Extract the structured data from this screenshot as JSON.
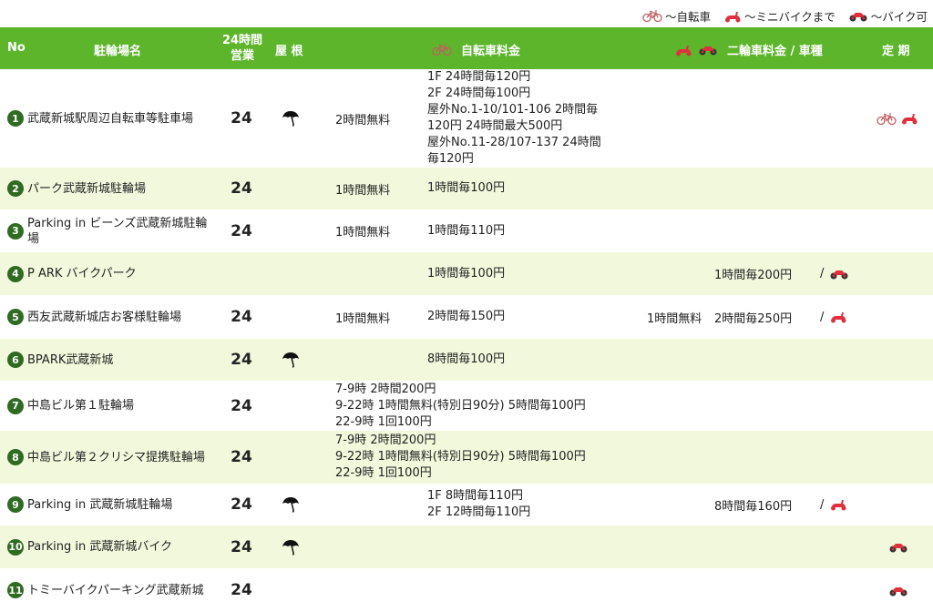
{
  "legend": [
    {
      "icon": "bicycle-icon",
      "label": "～自転車"
    },
    {
      "icon": "scooter-icon",
      "label": "～ミニバイクまで"
    },
    {
      "icon": "motorcycle-icon",
      "label": "～バイク可"
    }
  ],
  "header": {
    "no": "No",
    "name": "駐輪場名",
    "h24_line1": "24時間",
    "h24_line2": "営業",
    "roof": "屋 根",
    "bike_fee": "自転車料金",
    "moto_fee": "二輪車料金 / 車種",
    "pass": "定 期"
  },
  "colors": {
    "header_bg": "#5db52b",
    "alt_row": "#f2f8dc",
    "number_badge": "#2f6b22",
    "scooter": "#e0303c"
  },
  "rows": [
    {
      "no": "1",
      "name": "武蔵新城駅周辺自転車等駐車場",
      "h24": "24",
      "roof": true,
      "free": "2時間無料",
      "fees": [
        "1F 24時間毎120円",
        "2F 24時間毎100円",
        "屋外No.1-10/101-106 2時間毎",
        "120円 24時間最大500円",
        "屋外No.11-28/107-137 24時間",
        "毎120円"
      ],
      "moto_free": "",
      "moto_fee": "",
      "moto_type": "",
      "pass": [
        "bicycle-icon",
        "scooter-icon"
      ]
    },
    {
      "no": "2",
      "name": "パーク武蔵新城駐輪場",
      "h24": "24",
      "roof": false,
      "free": "1時間無料",
      "fees": [
        "1時間毎100円"
      ],
      "moto_free": "",
      "moto_fee": "",
      "moto_type": "",
      "pass": []
    },
    {
      "no": "3",
      "name": "Parking in ビーンズ武蔵新城駐輪場",
      "h24": "24",
      "roof": false,
      "free": "1時間無料",
      "fees": [
        "1時間毎110円"
      ],
      "moto_free": "",
      "moto_fee": "",
      "moto_type": "",
      "pass": []
    },
    {
      "no": "4",
      "name": "P ARK バイクパーク",
      "h24": "",
      "roof": false,
      "free": "",
      "fees": [
        "1時間毎100円"
      ],
      "moto_free": "",
      "moto_fee": "1時間毎200円",
      "moto_type": "motorcycle-icon",
      "pass": []
    },
    {
      "no": "5",
      "name": "西友武蔵新城店お客様駐輪場",
      "h24": "24",
      "roof": false,
      "free": "1時間無料",
      "fees": [
        "2時間毎150円"
      ],
      "moto_free": "1時間無料",
      "moto_fee": "2時間毎250円",
      "moto_type": "scooter-icon",
      "pass": []
    },
    {
      "no": "6",
      "name": "BPARK武蔵新城",
      "h24": "24",
      "roof": true,
      "free": "",
      "fees": [
        "8時間毎100円"
      ],
      "moto_free": "",
      "moto_fee": "",
      "moto_type": "",
      "pass": []
    },
    {
      "no": "7",
      "name": "中島ビル第１駐輪場",
      "h24": "24",
      "roof": false,
      "span": [
        "7-9時 2時間200円",
        "9-22時 1時間無料(特別日90分) 5時間毎100円",
        "22-9時 1回100円"
      ],
      "moto_free": "",
      "moto_fee": "",
      "moto_type": "",
      "pass": []
    },
    {
      "no": "8",
      "name": "中島ビル第２クリシマ提携駐輪場",
      "h24": "24",
      "roof": false,
      "span": [
        "7-9時 2時間200円",
        "9-22時 1時間無料(特別日90分) 5時間毎100円",
        "22-9時 1回100円"
      ],
      "moto_free": "",
      "moto_fee": "",
      "moto_type": "",
      "pass": []
    },
    {
      "no": "9",
      "name": "Parking in 武蔵新城駐輪場",
      "h24": "24",
      "roof": true,
      "free": "",
      "fees": [
        "1F 8時間毎110円",
        "2F 12時間毎110円"
      ],
      "moto_free": "",
      "moto_fee": "8時間毎160円",
      "moto_type": "scooter-icon",
      "pass": []
    },
    {
      "no": "10",
      "name": "Parking in 武蔵新城バイク",
      "h24": "24",
      "roof": true,
      "free": "",
      "fees": [],
      "moto_free": "",
      "moto_fee": "",
      "moto_type": "",
      "pass": [
        "motorcycle-icon"
      ]
    },
    {
      "no": "11",
      "name": "トミーバイクパーキング武蔵新城",
      "h24": "24",
      "roof": false,
      "free": "",
      "fees": [],
      "moto_free": "",
      "moto_fee": "",
      "moto_type": "",
      "pass": [
        "motorcycle-icon"
      ]
    }
  ]
}
